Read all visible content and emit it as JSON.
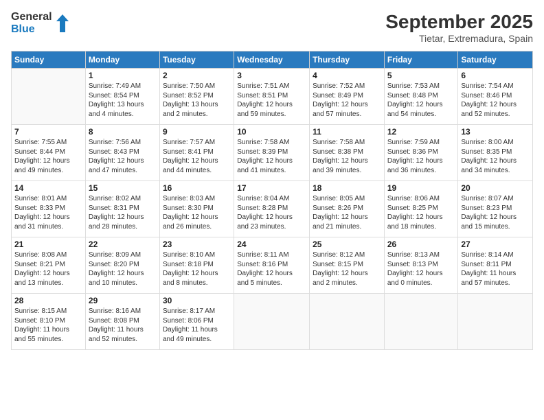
{
  "logo": {
    "text1": "General",
    "text2": "Blue"
  },
  "header": {
    "month": "September 2025",
    "location": "Tietar, Extremadura, Spain"
  },
  "weekdays": [
    "Sunday",
    "Monday",
    "Tuesday",
    "Wednesday",
    "Thursday",
    "Friday",
    "Saturday"
  ],
  "weeks": [
    [
      {
        "day": "",
        "info": ""
      },
      {
        "day": "1",
        "info": "Sunrise: 7:49 AM\nSunset: 8:54 PM\nDaylight: 13 hours\nand 4 minutes."
      },
      {
        "day": "2",
        "info": "Sunrise: 7:50 AM\nSunset: 8:52 PM\nDaylight: 13 hours\nand 2 minutes."
      },
      {
        "day": "3",
        "info": "Sunrise: 7:51 AM\nSunset: 8:51 PM\nDaylight: 12 hours\nand 59 minutes."
      },
      {
        "day": "4",
        "info": "Sunrise: 7:52 AM\nSunset: 8:49 PM\nDaylight: 12 hours\nand 57 minutes."
      },
      {
        "day": "5",
        "info": "Sunrise: 7:53 AM\nSunset: 8:48 PM\nDaylight: 12 hours\nand 54 minutes."
      },
      {
        "day": "6",
        "info": "Sunrise: 7:54 AM\nSunset: 8:46 PM\nDaylight: 12 hours\nand 52 minutes."
      }
    ],
    [
      {
        "day": "7",
        "info": "Sunrise: 7:55 AM\nSunset: 8:44 PM\nDaylight: 12 hours\nand 49 minutes."
      },
      {
        "day": "8",
        "info": "Sunrise: 7:56 AM\nSunset: 8:43 PM\nDaylight: 12 hours\nand 47 minutes."
      },
      {
        "day": "9",
        "info": "Sunrise: 7:57 AM\nSunset: 8:41 PM\nDaylight: 12 hours\nand 44 minutes."
      },
      {
        "day": "10",
        "info": "Sunrise: 7:58 AM\nSunset: 8:39 PM\nDaylight: 12 hours\nand 41 minutes."
      },
      {
        "day": "11",
        "info": "Sunrise: 7:58 AM\nSunset: 8:38 PM\nDaylight: 12 hours\nand 39 minutes."
      },
      {
        "day": "12",
        "info": "Sunrise: 7:59 AM\nSunset: 8:36 PM\nDaylight: 12 hours\nand 36 minutes."
      },
      {
        "day": "13",
        "info": "Sunrise: 8:00 AM\nSunset: 8:35 PM\nDaylight: 12 hours\nand 34 minutes."
      }
    ],
    [
      {
        "day": "14",
        "info": "Sunrise: 8:01 AM\nSunset: 8:33 PM\nDaylight: 12 hours\nand 31 minutes."
      },
      {
        "day": "15",
        "info": "Sunrise: 8:02 AM\nSunset: 8:31 PM\nDaylight: 12 hours\nand 28 minutes."
      },
      {
        "day": "16",
        "info": "Sunrise: 8:03 AM\nSunset: 8:30 PM\nDaylight: 12 hours\nand 26 minutes."
      },
      {
        "day": "17",
        "info": "Sunrise: 8:04 AM\nSunset: 8:28 PM\nDaylight: 12 hours\nand 23 minutes."
      },
      {
        "day": "18",
        "info": "Sunrise: 8:05 AM\nSunset: 8:26 PM\nDaylight: 12 hours\nand 21 minutes."
      },
      {
        "day": "19",
        "info": "Sunrise: 8:06 AM\nSunset: 8:25 PM\nDaylight: 12 hours\nand 18 minutes."
      },
      {
        "day": "20",
        "info": "Sunrise: 8:07 AM\nSunset: 8:23 PM\nDaylight: 12 hours\nand 15 minutes."
      }
    ],
    [
      {
        "day": "21",
        "info": "Sunrise: 8:08 AM\nSunset: 8:21 PM\nDaylight: 12 hours\nand 13 minutes."
      },
      {
        "day": "22",
        "info": "Sunrise: 8:09 AM\nSunset: 8:20 PM\nDaylight: 12 hours\nand 10 minutes."
      },
      {
        "day": "23",
        "info": "Sunrise: 8:10 AM\nSunset: 8:18 PM\nDaylight: 12 hours\nand 8 minutes."
      },
      {
        "day": "24",
        "info": "Sunrise: 8:11 AM\nSunset: 8:16 PM\nDaylight: 12 hours\nand 5 minutes."
      },
      {
        "day": "25",
        "info": "Sunrise: 8:12 AM\nSunset: 8:15 PM\nDaylight: 12 hours\nand 2 minutes."
      },
      {
        "day": "26",
        "info": "Sunrise: 8:13 AM\nSunset: 8:13 PM\nDaylight: 12 hours\nand 0 minutes."
      },
      {
        "day": "27",
        "info": "Sunrise: 8:14 AM\nSunset: 8:11 PM\nDaylight: 11 hours\nand 57 minutes."
      }
    ],
    [
      {
        "day": "28",
        "info": "Sunrise: 8:15 AM\nSunset: 8:10 PM\nDaylight: 11 hours\nand 55 minutes."
      },
      {
        "day": "29",
        "info": "Sunrise: 8:16 AM\nSunset: 8:08 PM\nDaylight: 11 hours\nand 52 minutes."
      },
      {
        "day": "30",
        "info": "Sunrise: 8:17 AM\nSunset: 8:06 PM\nDaylight: 11 hours\nand 49 minutes."
      },
      {
        "day": "",
        "info": ""
      },
      {
        "day": "",
        "info": ""
      },
      {
        "day": "",
        "info": ""
      },
      {
        "day": "",
        "info": ""
      }
    ]
  ]
}
